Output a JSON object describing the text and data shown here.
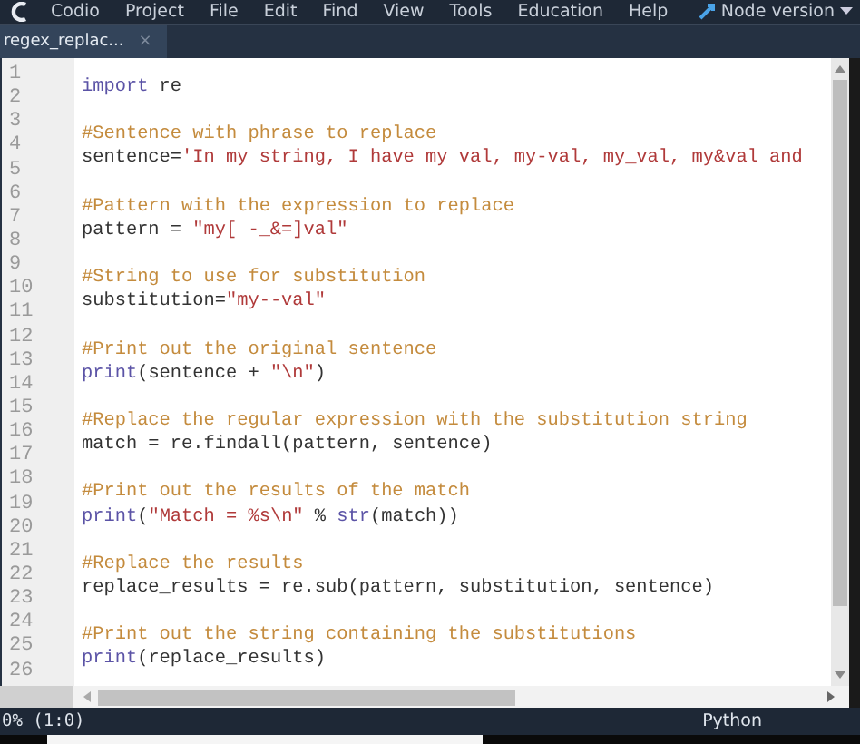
{
  "menu_bar": {
    "items": [
      "Codio",
      "Project",
      "File",
      "Edit",
      "Find",
      "View",
      "Tools",
      "Education",
      "Help"
    ],
    "node_version": "Node version"
  },
  "tabs": [
    {
      "label": "regex_replac...",
      "close": "×",
      "selected": true
    }
  ],
  "editor": {
    "lines": [
      {
        "number": "1",
        "tokens": [
          {
            "kind": "keyword",
            "text": "import"
          },
          {
            "kind": "plain",
            "text": " re"
          }
        ]
      },
      {
        "number": "2"
      },
      {
        "number": "3",
        "tokens": [
          {
            "kind": "comment",
            "text": "#Sentence with phrase to replace"
          }
        ]
      },
      {
        "number": "4",
        "tokens": [
          {
            "kind": "plain",
            "text": "sentence="
          },
          {
            "kind": "string",
            "text": "'In my string, I have my val, my-val, my_val, my&val and"
          }
        ]
      },
      {
        "number": "5"
      },
      {
        "number": "6",
        "tokens": [
          {
            "kind": "comment",
            "text": "#Pattern with the expression to replace"
          }
        ]
      },
      {
        "number": "7",
        "tokens": [
          {
            "kind": "plain",
            "text": "pattern = "
          },
          {
            "kind": "string",
            "text": "\"my[ -_&=]val\""
          }
        ]
      },
      {
        "number": "8"
      },
      {
        "number": "9",
        "tokens": [
          {
            "kind": "comment",
            "text": "#String to use for substitution"
          }
        ]
      },
      {
        "number": "10",
        "tokens": [
          {
            "kind": "plain",
            "text": "substitution="
          },
          {
            "kind": "string",
            "text": "\"my--val\""
          }
        ]
      },
      {
        "number": "11"
      },
      {
        "number": "12",
        "tokens": [
          {
            "kind": "comment",
            "text": "#Print out the original sentence"
          }
        ]
      },
      {
        "number": "13",
        "tokens": [
          {
            "kind": "keyword",
            "text": "print"
          },
          {
            "kind": "plain",
            "text": "(sentence + "
          },
          {
            "kind": "string",
            "text": "\"\\n\""
          },
          {
            "kind": "plain",
            "text": ")"
          }
        ]
      },
      {
        "number": "14"
      },
      {
        "number": "15",
        "tokens": [
          {
            "kind": "comment",
            "text": "#Replace the regular expression with the substitution string"
          }
        ]
      },
      {
        "number": "16",
        "tokens": [
          {
            "kind": "plain",
            "text": "match = re.findall(pattern, sentence)"
          }
        ]
      },
      {
        "number": "17"
      },
      {
        "number": "18",
        "tokens": [
          {
            "kind": "comment",
            "text": "#Print out the results of the match"
          }
        ]
      },
      {
        "number": "19",
        "tokens": [
          {
            "kind": "keyword",
            "text": "print"
          },
          {
            "kind": "plain",
            "text": "("
          },
          {
            "kind": "string",
            "text": "\"Match = %s\\n\""
          },
          {
            "kind": "plain",
            "text": " % "
          },
          {
            "kind": "keyword",
            "text": "str"
          },
          {
            "kind": "plain",
            "text": "(match))"
          }
        ]
      },
      {
        "number": "20"
      },
      {
        "number": "21",
        "tokens": [
          {
            "kind": "comment",
            "text": "#Replace the results"
          }
        ]
      },
      {
        "number": "22",
        "tokens": [
          {
            "kind": "plain",
            "text": "replace_results = re.sub(pattern, substitution, sentence)"
          }
        ]
      },
      {
        "number": "23"
      },
      {
        "number": "24",
        "tokens": [
          {
            "kind": "comment",
            "text": "#Print out the string containing the substitutions"
          }
        ]
      },
      {
        "number": "25",
        "tokens": [
          {
            "kind": "keyword",
            "text": "print"
          },
          {
            "kind": "plain",
            "text": "(replace_results)"
          }
        ]
      },
      {
        "number": "26"
      }
    ]
  },
  "status_bar": {
    "position": "0% (1:0)",
    "language": "Python"
  }
}
